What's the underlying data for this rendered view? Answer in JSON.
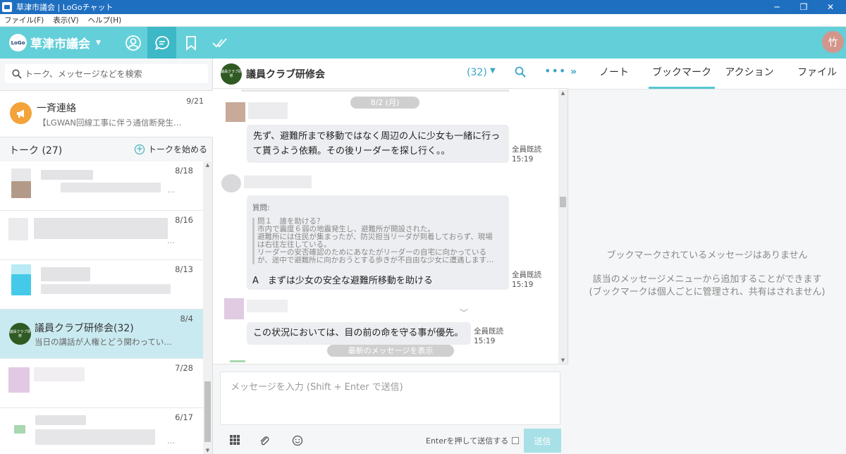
{
  "window": {
    "title": "草津市議会 | LoGoチャット",
    "minimize": "─",
    "maximize": "❐",
    "close": "✕"
  },
  "menu": [
    "ファイル(F)",
    "表示(V)",
    "ヘルプ(H)"
  ],
  "header": {
    "logo_text": "LoGo",
    "org_name": "草津市議会",
    "user_initial": "竹",
    "icons": [
      "person-icon",
      "chat-icon",
      "bookmark-icon",
      "check-icon"
    ],
    "accent": "#63cfd9"
  },
  "left": {
    "search_placeholder": "トーク、メッセージなどを検索",
    "notice": {
      "title": "一斉連絡",
      "preview": "【LGWAN回線工事に伴う通信断発生…",
      "date": "9/21"
    },
    "talk_header": "トーク (27)",
    "start_talk": "トークを始める",
    "items": [
      {
        "date": "8/18",
        "title": "",
        "preview": "…"
      },
      {
        "date": "8/16",
        "title": "",
        "preview": "…"
      },
      {
        "date": "8/13",
        "title": "",
        "preview": ""
      },
      {
        "date": "8/4",
        "title": "議員クラブ研修会(32)",
        "preview": "当日の講話が人権とどう関わってい…",
        "avatar_text": "議員クラブ研修"
      },
      {
        "date": "7/28",
        "title": "",
        "preview": ""
      },
      {
        "date": "6/17",
        "title": "",
        "preview": "…"
      }
    ]
  },
  "chat": {
    "title": "議員クラブ研修会",
    "member_count": "(32)",
    "avatar_text": "議員クラブ研修",
    "date_divider": "8/2 (月)",
    "messages": [
      {
        "text_line1": "先ず、避難所まで移動ではなく周辺の人に少女も一緒に行っ",
        "text_line2": "て貰うよう依頼。その後リーダーを探し行く。。",
        "read": "全員既読",
        "time": "15:19"
      },
      {
        "label": "質問:",
        "quote": [
          "問１　誰を助ける？",
          "市内で震度６弱の地震発生し、避難所が開設された。",
          "避難所には住民が集まったが、防災担当リーダが到着しておらず、現場",
          "は右往左往している。",
          "リーダーの安否確認のためにあなたがリーダーの自宅に向かっている",
          "が、途中で避難所に向かおうとする歩きが不自由な少女に遭遇します…"
        ],
        "answer": "A　まずは少女の安全な避難所移動を助ける",
        "read": "全員既読",
        "time": "15:19"
      },
      {
        "text": "この状況においては、目の前の命を守る事が優先。",
        "read": "全員既読",
        "time": "15:19"
      }
    ],
    "new_messages": "最新のメッセージを表示",
    "input_placeholder": "メッセージを入力 (Shift + Enter で送信)",
    "enter_to_send": "Enterを押して送信する",
    "send": "送信"
  },
  "right": {
    "tabs": [
      "ノート",
      "ブックマーク",
      "アクション",
      "ファイル"
    ],
    "active_tab": "ブックマーク",
    "empty_title": "ブックマークされているメッセージはありません",
    "empty_line1": "該当のメッセージメニューから追加することができます",
    "empty_line2": "(ブックマークは個人ごとに管理され、共有はされません)"
  }
}
